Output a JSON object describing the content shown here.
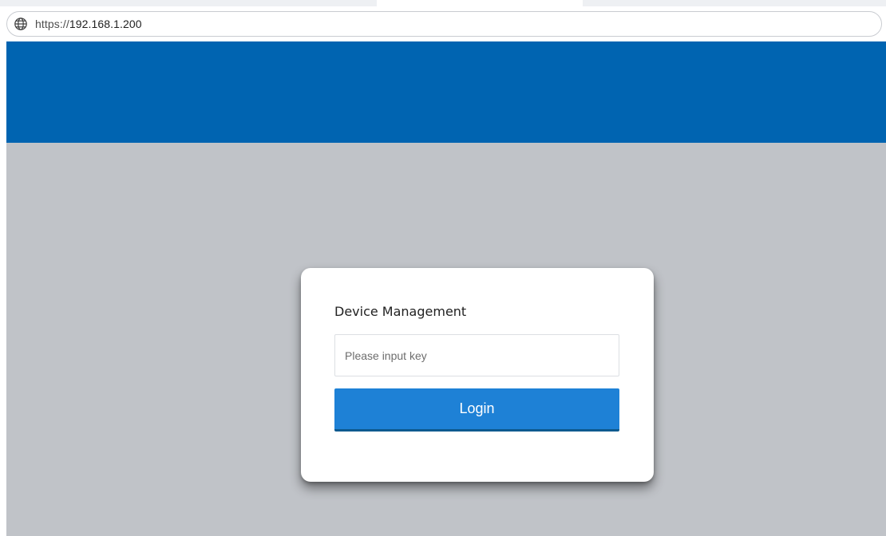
{
  "browser": {
    "url_scheme": "https://",
    "url_host": "192.168.1.200",
    "globe_icon": "globe-icon"
  },
  "login": {
    "title": "Device Management",
    "key_placeholder": "Please input key",
    "key_value": "",
    "login_label": "Login"
  },
  "colors": {
    "header_band": "#0064b1",
    "page_background": "#c0c3c8",
    "login_button": "#1e81d6"
  }
}
